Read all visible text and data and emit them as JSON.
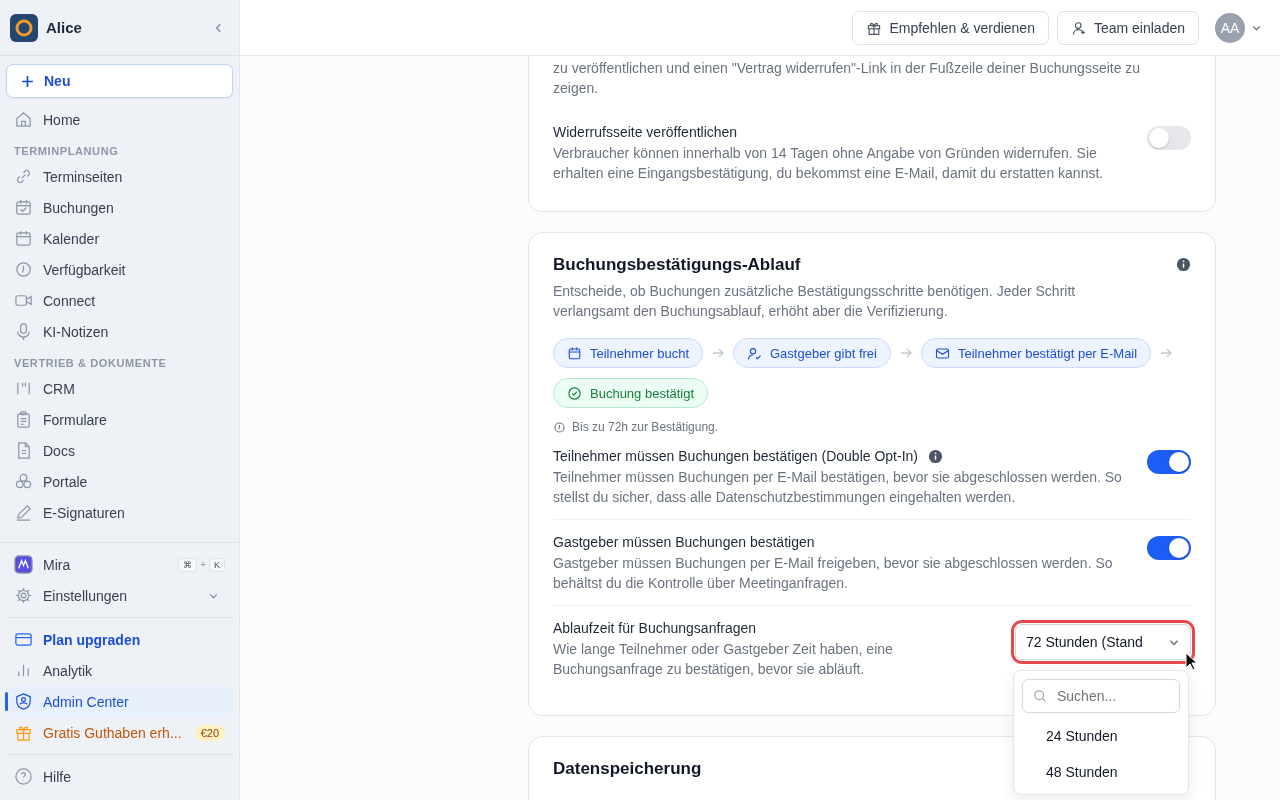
{
  "sidebar": {
    "workspace": "Alice",
    "new_button": "Neu",
    "items": [
      {
        "kind": "item",
        "label": "Home",
        "selected": false
      },
      {
        "kind": "heading",
        "label": "TERMINPLANUNG"
      },
      {
        "kind": "item",
        "label": "Terminseiten",
        "selected": false
      },
      {
        "kind": "item",
        "label": "Buchungen",
        "selected": false
      },
      {
        "kind": "item",
        "label": "Kalender",
        "selected": false
      },
      {
        "kind": "item",
        "label": "Verfügbarkeit",
        "selected": false
      },
      {
        "kind": "item",
        "label": "Connect",
        "selected": false
      },
      {
        "kind": "item",
        "label": "KI-Notizen",
        "selected": false
      },
      {
        "kind": "heading",
        "label": "VERTRIEB & DOKUMENTE"
      },
      {
        "kind": "item",
        "label": "CRM",
        "selected": false
      },
      {
        "kind": "item",
        "label": "Formulare",
        "selected": false
      },
      {
        "kind": "item",
        "label": "Docs",
        "selected": false
      },
      {
        "kind": "item",
        "label": "Portale",
        "selected": false
      },
      {
        "kind": "item",
        "label": "E-Signaturen",
        "selected": false
      }
    ],
    "mira": {
      "label": "Mira",
      "shortcut": [
        "⌘",
        "+",
        "K"
      ]
    },
    "settings": {
      "label": "Einstellungen",
      "expanded": false
    },
    "bottom": [
      {
        "kind": "upgrade",
        "label": "Plan upgraden",
        "selected": false
      },
      {
        "kind": "item",
        "label": "Analytik",
        "selected": false
      },
      {
        "kind": "item",
        "label": "Admin Center",
        "selected": true
      },
      {
        "kind": "promo",
        "label": "Gratis Guthaben erh...",
        "badge": "€20",
        "selected": false
      }
    ],
    "help": "Hilfe"
  },
  "header": {
    "buttons": [
      "Empfehlen & verdienen",
      "Team einladen"
    ],
    "avatar": "AA"
  },
  "cards": [
    {
      "kind": "partial",
      "intro": "zu veröffentlichen und einen \"Vertrag widerrufen\"-Link in der Fußzeile deiner Buchungsseite zu zeigen.",
      "settings": [
        {
          "kind": "toggle",
          "title": "Widerrufsseite veröffentlichen",
          "text": "Verbraucher können innerhalb von 14 Tagen ohne Angabe von Gründen widerrufen. Sie erhalten eine Eingangsbestätigung, du bekommst eine E-Mail, damit du erstatten kannst.",
          "on": false
        }
      ]
    },
    {
      "kind": "full",
      "title": "Buchungsbestätigungs-Ablauf",
      "text": "Entscheide, ob Buchungen zusätzliche Bestätigungsschritte benötigen. Jeder Schritt verlangsamt den Buchungsablauf, erhöht aber die Verifizierung.",
      "steps": [
        {
          "label": "Teilnehmer bucht",
          "kind": "step"
        },
        {
          "label": "Gastgeber gibt frei",
          "kind": "step"
        },
        {
          "label": "Teilnehmer bestätigt per E-Mail",
          "kind": "step"
        },
        {
          "label": "Buchung bestätigt",
          "kind": "done"
        }
      ],
      "note": "Bis zu 72h zur Bestätigung.",
      "settings": [
        {
          "kind": "toggle",
          "title": "Teilnehmer müssen Buchungen bestätigen (Double Opt-In)",
          "info": true,
          "text": "Teilnehmer müssen Buchungen per E-Mail bestätigen, bevor sie abgeschlossen werden. So stellst du sicher, dass alle Datenschutzbestimmungen eingehalten werden.",
          "on": true
        },
        {
          "kind": "toggle",
          "title": "Gastgeber müssen Buchungen bestätigen",
          "text": "Gastgeber müssen Buchungen per E-Mail freigeben, bevor sie abgeschlossen werden. So behältst du die Kontrolle über Meetinganfragen.",
          "on": true
        },
        {
          "kind": "select",
          "title": "Ablaufzeit für Buchungsanfragen",
          "text": "Wie lange Teilnehmer oder Gastgeber Zeit haben, eine Buchungsanfrage zu bestätigen, bevor sie abläuft.",
          "value": "72 Stunden (Stand",
          "expanded": true,
          "search_placeholder": "Suchen...",
          "options": [
            "24 Stunden",
            "48 Stunden"
          ]
        }
      ]
    },
    {
      "kind": "cut",
      "title": "Datenspeicherung"
    }
  ]
}
